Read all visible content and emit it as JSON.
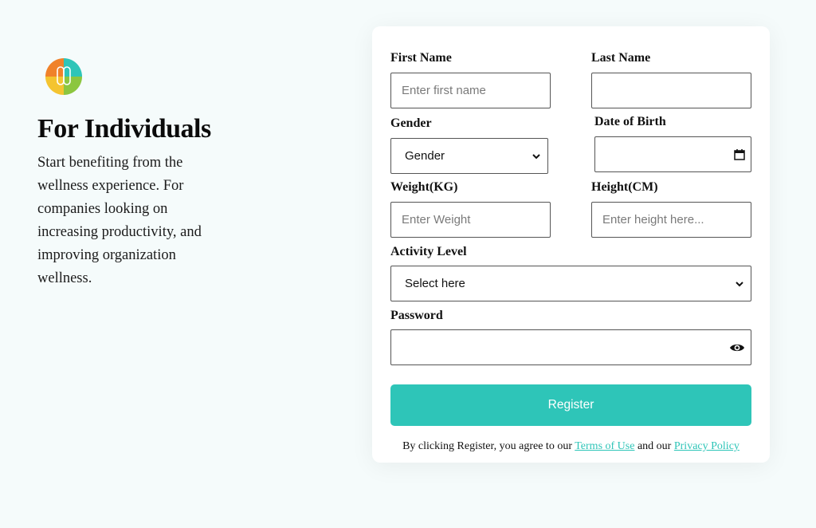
{
  "colors": {
    "accent": "#2ec5b8",
    "background": "#f5fbfb"
  },
  "hero": {
    "title": "For Individuals",
    "description": "Start benefiting from the wellness experience. For companies looking on increasing productivity, and improving organization wellness."
  },
  "form": {
    "first_name": {
      "label": "First Name",
      "placeholder": "Enter first name"
    },
    "last_name": {
      "label": "Last Name",
      "placeholder": ""
    },
    "gender": {
      "label": "Gender",
      "value": "Gender"
    },
    "dob": {
      "label": "Date of Birth",
      "icon": "calendar-icon"
    },
    "weight": {
      "label": "Weight(KG)",
      "placeholder": "Enter Weight"
    },
    "height": {
      "label": "Height(CM)",
      "placeholder": "Enter height here..."
    },
    "activity": {
      "label": "Activity Level",
      "value": "Select here"
    },
    "password": {
      "label": "Password",
      "icon": "eye-icon"
    },
    "register_label": "Register",
    "terms_prefix": "By clicking Register, you agree to our ",
    "terms_link": "Terms of Use",
    "terms_mid": " and our ",
    "privacy_link": "Privacy Policy"
  }
}
